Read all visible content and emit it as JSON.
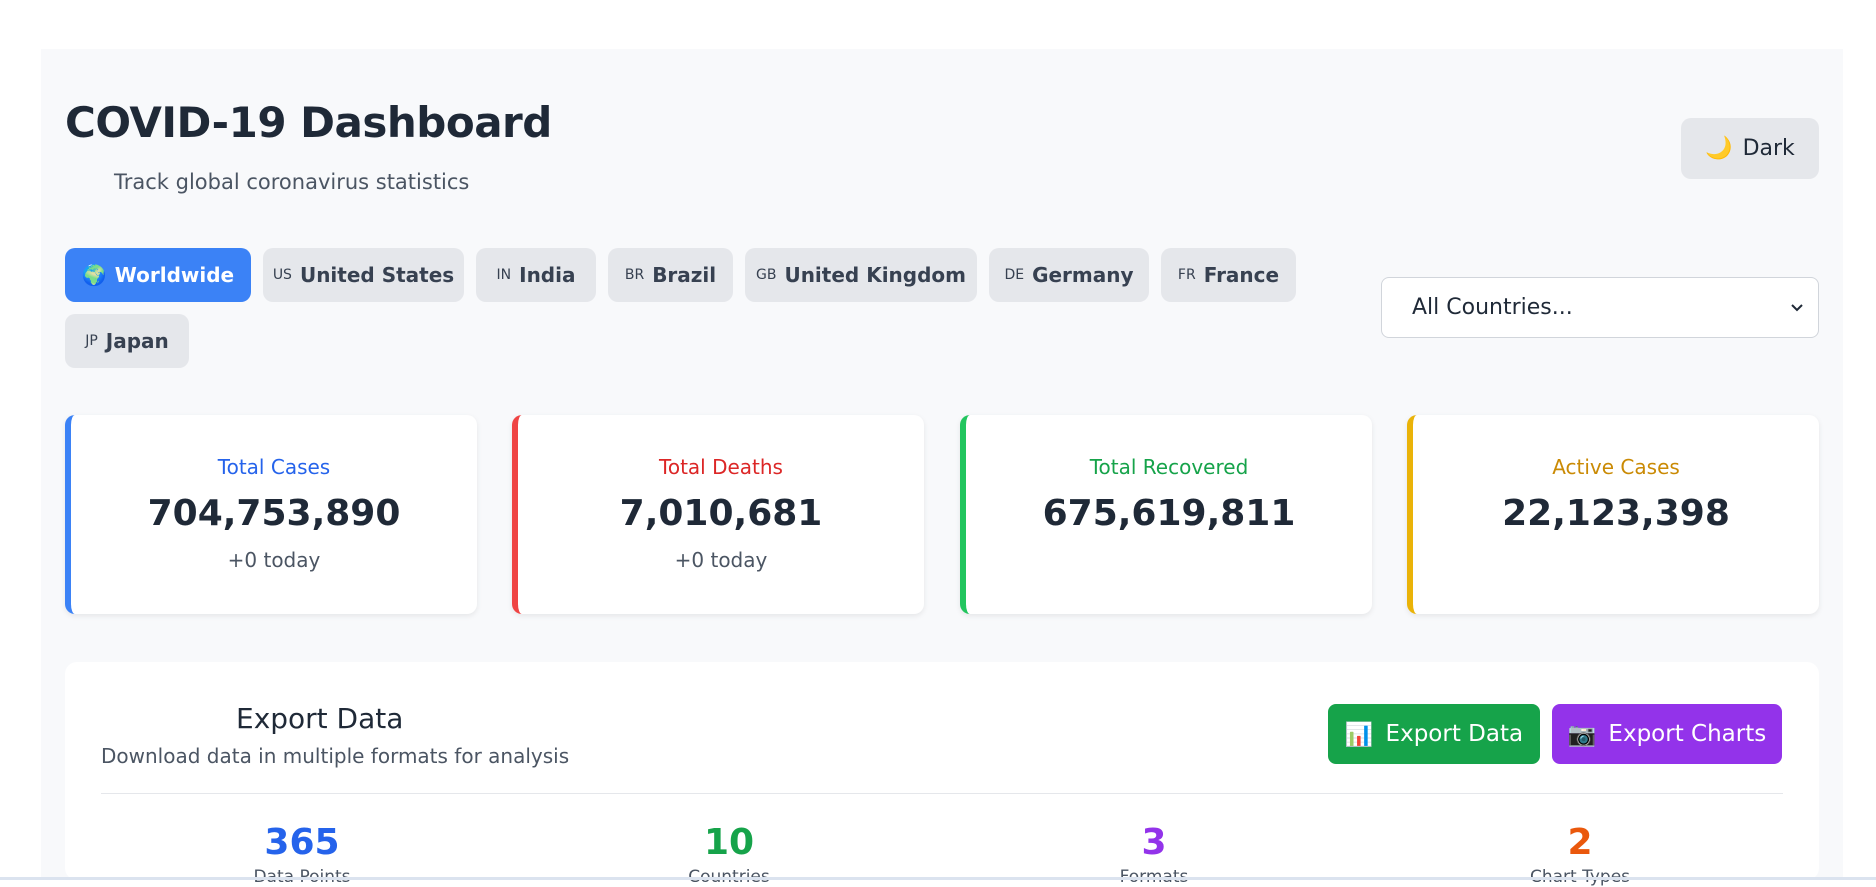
{
  "header": {
    "title": "COVID-19 Dashboard",
    "subtitle": "Track global coronavirus statistics",
    "theme_toggle": {
      "icon": "🌙",
      "label": "Dark"
    }
  },
  "tabs": [
    {
      "icon": "🌍",
      "label": "Worldwide",
      "active": true
    },
    {
      "code": "US",
      "label": "United States"
    },
    {
      "code": "IN",
      "label": "India"
    },
    {
      "code": "BR",
      "label": "Brazil"
    },
    {
      "code": "GB",
      "label": "United Kingdom"
    },
    {
      "code": "DE",
      "label": "Germany"
    },
    {
      "code": "FR",
      "label": "France"
    },
    {
      "code": "JP",
      "label": "Japan"
    }
  ],
  "country_select": {
    "value": "All Countries..."
  },
  "cards": [
    {
      "label": "Total Cases",
      "value": "704,753,890",
      "today": "+0 today",
      "color": "#2563eb",
      "border": "#3b82f6"
    },
    {
      "label": "Total Deaths",
      "value": "7,010,681",
      "today": "+0 today",
      "color": "#dc2626",
      "border": "#ef4444"
    },
    {
      "label": "Total Recovered",
      "value": "675,619,811",
      "today": "",
      "color": "#16a34a",
      "border": "#22c55e"
    },
    {
      "label": "Active Cases",
      "value": "22,123,398",
      "today": "",
      "color": "#ca8a04",
      "border": "#eab308"
    }
  ],
  "export": {
    "title": "Export Data",
    "description": "Download data in multiple formats for analysis",
    "export_data_button": {
      "icon": "📊",
      "label": "Export Data",
      "color": "#16a34a"
    },
    "export_charts_button": {
      "icon": "📷",
      "label": "Export Charts",
      "color": "#9333ea"
    },
    "stats": [
      {
        "value": "365",
        "label": "Data Points",
        "color": "#2563eb"
      },
      {
        "value": "10",
        "label": "Countries",
        "color": "#16a34a"
      },
      {
        "value": "3",
        "label": "Formats",
        "color": "#9333ea"
      },
      {
        "value": "2",
        "label": "Chart Types",
        "color": "#ea580c"
      }
    ]
  }
}
